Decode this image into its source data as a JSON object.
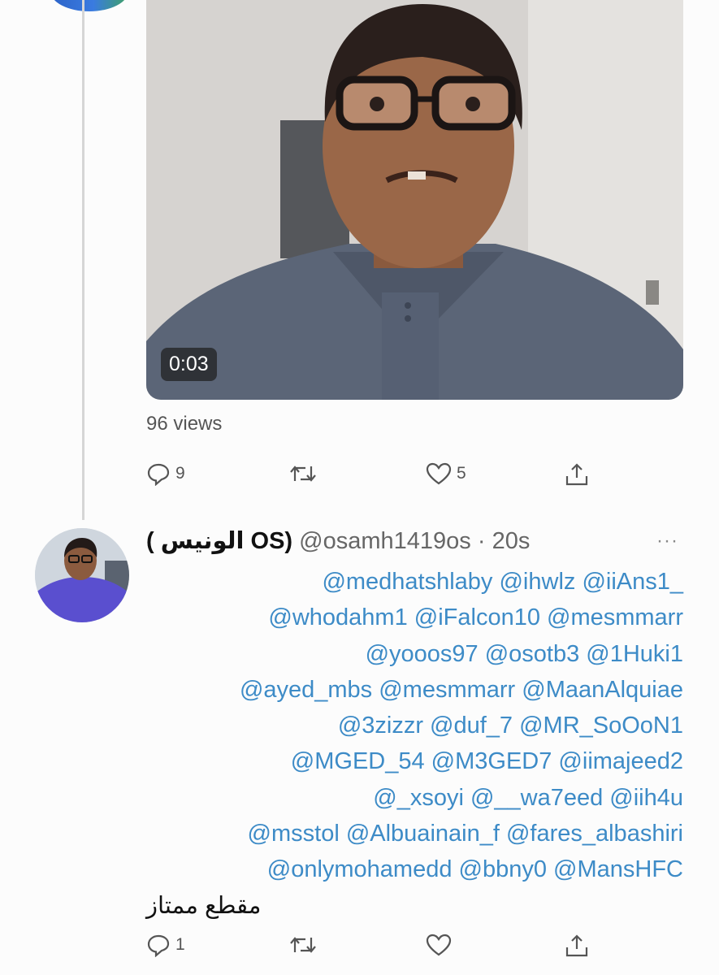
{
  "video": {
    "duration": "0:03",
    "views": "96 views",
    "actions": {
      "reply_count": "9",
      "retweet_count": "",
      "like_count": "5"
    }
  },
  "reply_tweet": {
    "display_name": "( الونيس OS)",
    "handle": "@osamh1419os",
    "separator": "·",
    "time": "20s",
    "more": "···",
    "mention_lines": [
      "@medhatshlaby @ihwlz @iiAns1_",
      "@whodahm1 @iFalcon10 @mesmmarr",
      "@yooos97 @osotb3 @1Huki1",
      "@ayed_mbs @mesmmarr @MaanAlquiae",
      "@3zizzr @duf_7 @MR_SoOoN1",
      "@MGED_54 @M3GED7 @iimajeed2",
      "@_xsoyi @__wa7eed @iih4u",
      "@msstol @Albuainain_f @fares_albashiri",
      "@onlymohamedd @bbny0 @MansHFC"
    ],
    "text": "مقطع ممتاز",
    "actions": {
      "reply_count": "1",
      "retweet_count": "",
      "like_count": ""
    }
  },
  "colors": {
    "mention": "#3d8bc7",
    "muted": "#555555",
    "thread_line": "#d6d6d6"
  }
}
